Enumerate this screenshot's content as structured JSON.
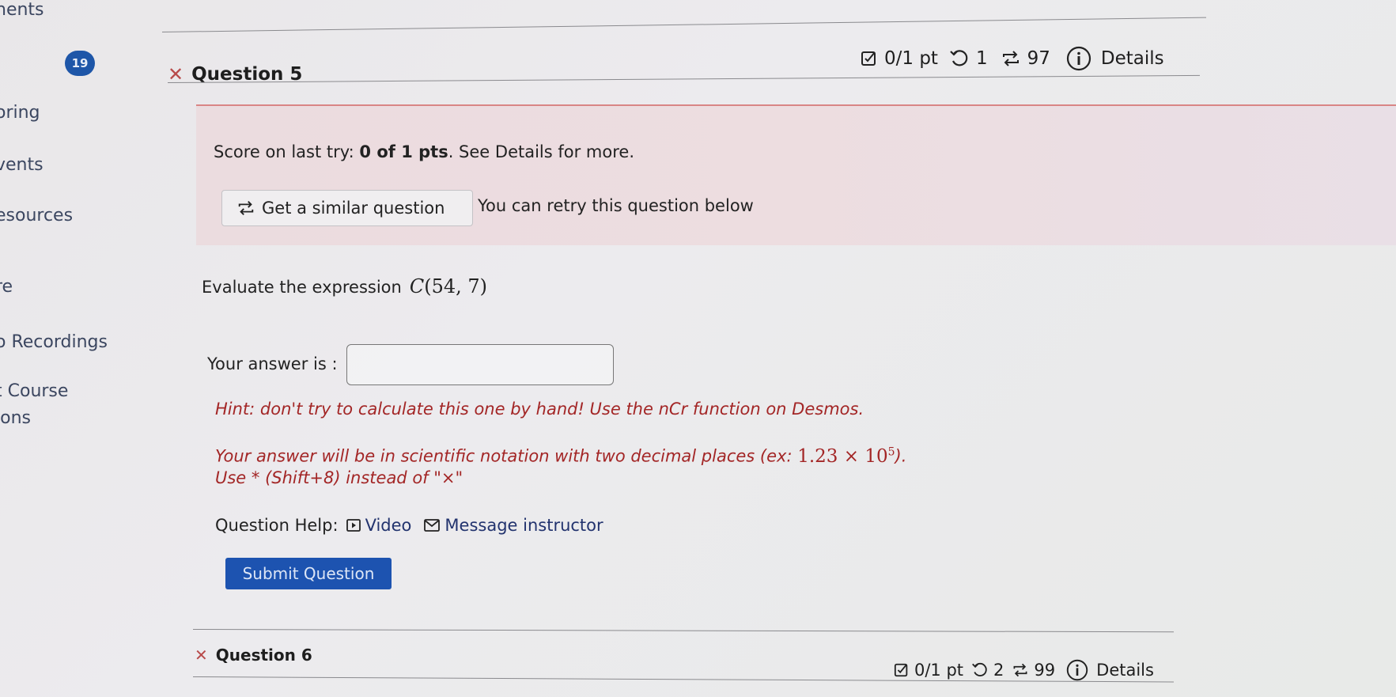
{
  "sidebar": {
    "items": [
      {
        "label": "nents"
      },
      {
        "label": "oring"
      },
      {
        "label": "vents"
      },
      {
        "label": "esources"
      },
      {
        "label": "re"
      },
      {
        "label": "o Recordings"
      },
      {
        "label": "t Course"
      },
      {
        "label": "ions"
      }
    ],
    "badge": "19"
  },
  "question5": {
    "title": "Question 5",
    "status_icon": "x-mark",
    "points": "0/1 pt",
    "attempts": "1",
    "retries": "97",
    "details_label": "Details",
    "score_prefix": "Score on last try: ",
    "score_bold": "0 of 1 pts",
    "score_suffix": ". See Details for more.",
    "similar_button": "Get a similar question",
    "retry_text": "You can retry this question below",
    "prompt": "Evaluate the expression",
    "expression": {
      "func": "C",
      "args": "(54, 7)"
    },
    "answer_label": "Your answer is :",
    "answer_value": "",
    "hint": "Hint: don't try to calculate this one by hand! Use the nCr function on Desmos.",
    "format_note_prefix": "Your answer will be in scientific notation with two decimal places (ex: ",
    "format_example": {
      "mantissa": "1.23",
      "times": "×",
      "base": "10",
      "exponent": "5"
    },
    "format_note_suffix": ").",
    "use_note": "Use * (Shift+8) instead of \"×\"",
    "help_label": "Question Help:",
    "video_link": "Video",
    "message_link": "Message instructor",
    "submit_button": "Submit Question"
  },
  "question6": {
    "title": "Question 6",
    "status_icon": "x-mark",
    "points": "0/1 pt",
    "attempts": "2",
    "retries": "99",
    "details_label": "Details"
  },
  "colors": {
    "accent_blue": "#1d53b0",
    "badge_blue": "#1e56a8",
    "hint_red": "#a32626",
    "incorrect_panel": "#ebdcdf",
    "link_navy": "#22336e"
  }
}
